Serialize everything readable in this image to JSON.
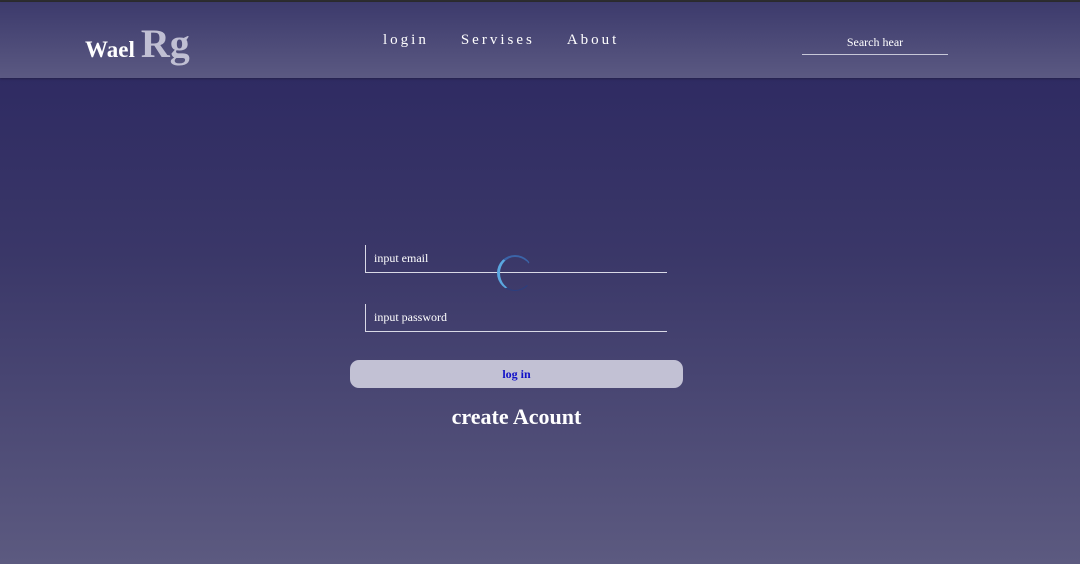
{
  "header": {
    "logo": {
      "first": "Wael",
      "second": "Rg"
    },
    "nav": [
      {
        "label": "login"
      },
      {
        "label": "Servises"
      },
      {
        "label": "About"
      }
    ],
    "search": {
      "placeholder": "Search hear"
    }
  },
  "form": {
    "email_placeholder": "input email",
    "password_placeholder": "input password",
    "spinner_icon": "loading-spinner-icon",
    "login_label": "log in",
    "create_label": "create Acount"
  },
  "colors": {
    "background_top": "#2a2660",
    "background_bottom": "#5c5a80",
    "header": "#4a4875",
    "button": "#c2c1d4",
    "button_text": "#1010c8"
  }
}
